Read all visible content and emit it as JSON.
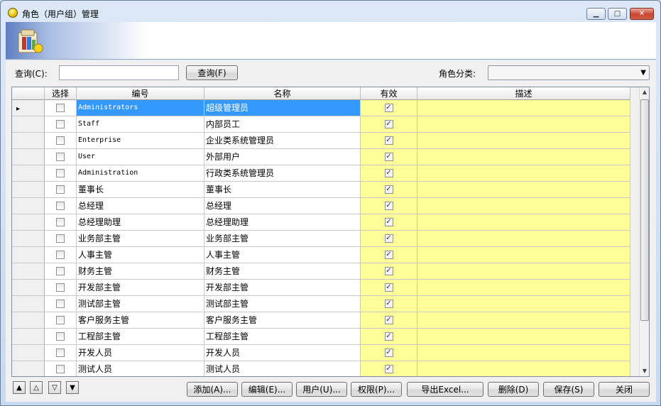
{
  "window": {
    "title": "角色（用户组）管理",
    "min_label": "▭",
    "max_label": "□",
    "close_label": "✕"
  },
  "search": {
    "label": "查询(C):",
    "value": "",
    "placeholder": "",
    "button_label": "查询(F)",
    "category_label": "角色分类:",
    "category_value": ""
  },
  "grid": {
    "columns": [
      "选择",
      "编号",
      "名称",
      "有效",
      "描述"
    ],
    "rows": [
      {
        "code": "Administrators",
        "name": "超级管理员",
        "selected": false,
        "valid": true,
        "desc": ""
      },
      {
        "code": "Staff",
        "name": "内部员工",
        "selected": false,
        "valid": true,
        "desc": ""
      },
      {
        "code": "Enterprise",
        "name": "企业类系统管理员",
        "selected": false,
        "valid": true,
        "desc": ""
      },
      {
        "code": "User",
        "name": "外部用户",
        "selected": false,
        "valid": true,
        "desc": ""
      },
      {
        "code": "Administration",
        "name": "行政类系统管理员",
        "selected": false,
        "valid": true,
        "desc": ""
      },
      {
        "code": "董事长",
        "name": "董事长",
        "selected": false,
        "valid": true,
        "desc": ""
      },
      {
        "code": "总经理",
        "name": "总经理",
        "selected": false,
        "valid": true,
        "desc": ""
      },
      {
        "code": "总经理助理",
        "name": "总经理助理",
        "selected": false,
        "valid": true,
        "desc": ""
      },
      {
        "code": "业务部主管",
        "name": "业务部主管",
        "selected": false,
        "valid": true,
        "desc": ""
      },
      {
        "code": "人事主管",
        "name": "人事主管",
        "selected": false,
        "valid": true,
        "desc": ""
      },
      {
        "code": "财务主管",
        "name": "财务主管",
        "selected": false,
        "valid": true,
        "desc": ""
      },
      {
        "code": "开发部主管",
        "name": "开发部主管",
        "selected": false,
        "valid": true,
        "desc": ""
      },
      {
        "code": "测试部主管",
        "name": "测试部主管",
        "selected": false,
        "valid": true,
        "desc": ""
      },
      {
        "code": "客户服务主管",
        "name": "客户服务主管",
        "selected": false,
        "valid": true,
        "desc": ""
      },
      {
        "code": "工程部主管",
        "name": "工程部主管",
        "selected": false,
        "valid": true,
        "desc": ""
      },
      {
        "code": "开发人员",
        "name": "开发人员",
        "selected": false,
        "valid": true,
        "desc": ""
      },
      {
        "code": "测试人员",
        "name": "测试人员",
        "selected": false,
        "valid": true,
        "desc": ""
      }
    ],
    "current_row_marker": "▸",
    "selection_color": "#3399ff",
    "desc_color": "#ffff99"
  },
  "nav": {
    "first": "▲",
    "prev": "△",
    "next": "▽",
    "last": "▼"
  },
  "actions": {
    "add": "添加(A)...",
    "edit": "编辑(E)...",
    "users": "用户(U)...",
    "permissions": "权限(P)...",
    "export": "导出Excel...",
    "delete": "删除(D)",
    "save": "保存(S)",
    "close": "关闭"
  }
}
